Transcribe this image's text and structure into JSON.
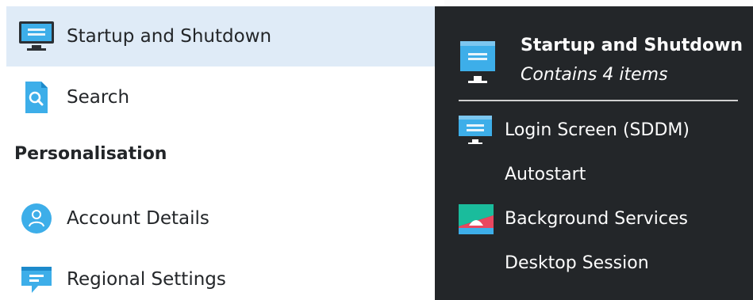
{
  "sidebar": {
    "items": [
      {
        "label": "Startup and Shutdown",
        "icon": "monitor-icon",
        "selected": true
      },
      {
        "label": "Search",
        "icon": "search-document-icon"
      },
      {
        "label": "Account Details",
        "icon": "account-icon"
      },
      {
        "label": "Regional Settings",
        "icon": "speech-bubble-icon"
      }
    ],
    "section_header": "Personalisation"
  },
  "popup": {
    "title": "Startup and Shutdown",
    "subtitle": "Contains 4 items",
    "items": [
      {
        "label": "Login Screen (SDDM)",
        "icon": "monitor-icon"
      },
      {
        "label": "Autostart",
        "icon": ""
      },
      {
        "label": "Background Services",
        "icon": "background-services-icon"
      },
      {
        "label": "Desktop Session",
        "icon": ""
      }
    ]
  },
  "colors": {
    "selection": "#dfebf7",
    "popup_bg": "#232629",
    "accent": "#3daee9"
  }
}
